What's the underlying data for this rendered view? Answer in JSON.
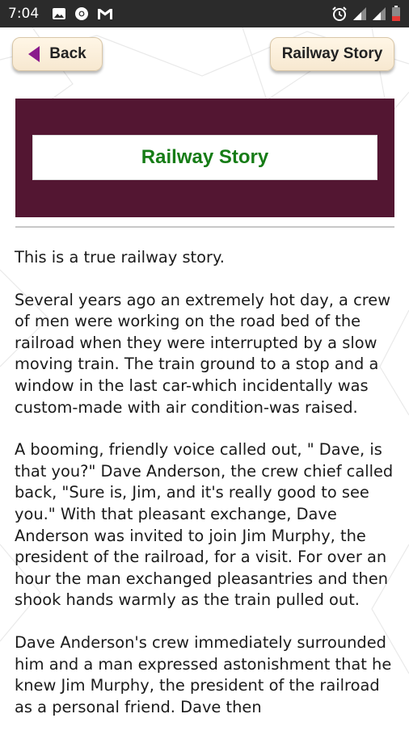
{
  "status_bar": {
    "time": "7:04",
    "left_icons": [
      "image-icon",
      "chrome-icon",
      "gmail-icon"
    ],
    "right_icons": [
      "alarm-icon",
      "signal-icon",
      "signal-icon",
      "battery-low-icon"
    ]
  },
  "toolbar": {
    "back_label": "Back",
    "title_label": "Railway Story"
  },
  "banner": {
    "title": "Railway Story"
  },
  "story": {
    "paragraphs": [
      "This is a true railway story.",
      "Several years ago an extremely hot day, a crew of men were working on the road bed of the railroad when they were interrupted by a slow moving train. The train ground to a stop and a window in the last car-which incidentally was custom-made with air condition-was raised.",
      "A booming, friendly voice called out, \" Dave, is that you?\" Dave Anderson, the crew chief called back, \"Sure is, Jim, and it's really good to see you.\" With that pleasant exchange, Dave Anderson was invited to join Jim Murphy, the president of the railroad, for a visit. For over an hour the man exchanged pleasantries and then shook hands warmly as the train pulled out.",
      "Dave Anderson's crew immediately surrounded him and a man expressed astonishment that he knew Jim Murphy, the president of the railroad as a personal friend. Dave then"
    ]
  },
  "colors": {
    "banner_bg": "#531632",
    "banner_title": "#167c16",
    "back_arrow": "#8a1a8c",
    "button_bg": "#fff6e6"
  }
}
